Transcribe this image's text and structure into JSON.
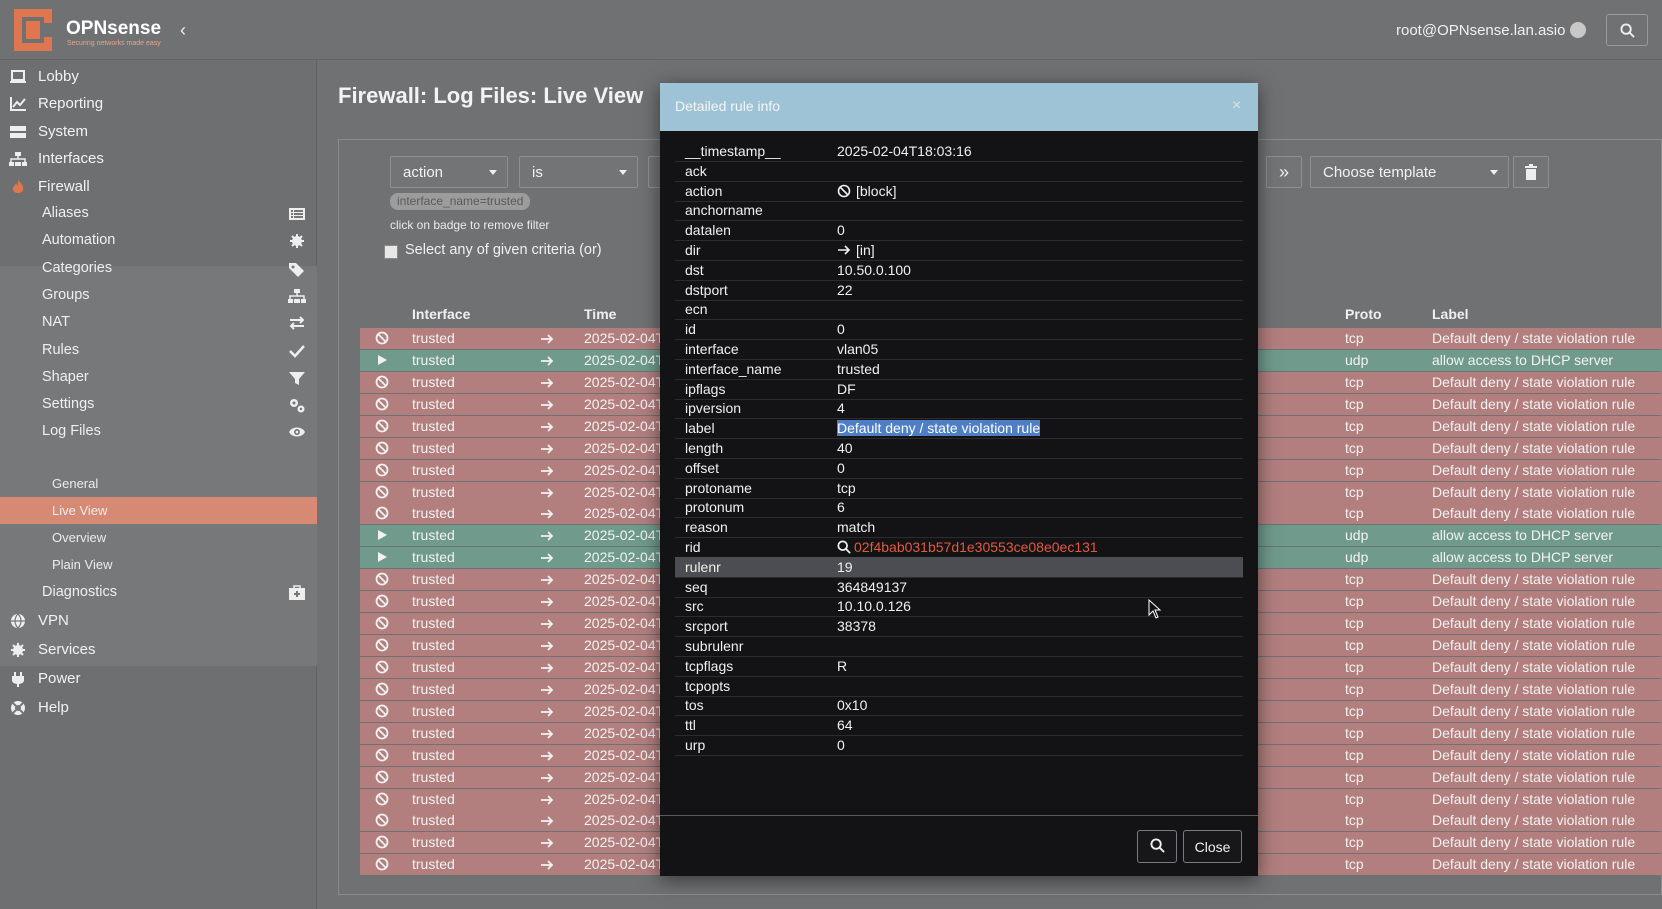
{
  "header": {
    "brand": "OPNsense",
    "tagline": "Securing networks made easy",
    "user": "root@OPNsense.lan.asio"
  },
  "sidebar": {
    "items": [
      {
        "label": "Lobby",
        "icon": "laptop-icon"
      },
      {
        "label": "Reporting",
        "icon": "chart-icon"
      },
      {
        "label": "System",
        "icon": "server-icon"
      },
      {
        "label": "Interfaces",
        "icon": "sitemap-icon"
      },
      {
        "label": "Firewall",
        "icon": "fire-icon"
      }
    ],
    "firewall_sub": [
      {
        "label": "Aliases",
        "icon": "list-icon"
      },
      {
        "label": "Automation",
        "icon": "gear-icon"
      },
      {
        "label": "Categories",
        "icon": "tags-icon"
      },
      {
        "label": "Groups",
        "icon": "sitemap-icon"
      },
      {
        "label": "NAT",
        "icon": "exchange-icon"
      },
      {
        "label": "Rules",
        "icon": "check-icon"
      },
      {
        "label": "Shaper",
        "icon": "filter-icon"
      },
      {
        "label": "Settings",
        "icon": "gears-icon"
      },
      {
        "label": "Log Files",
        "icon": "eye-icon"
      }
    ],
    "logfiles_sub": [
      "General",
      "Live View",
      "Overview",
      "Plain View"
    ],
    "diagnostics": {
      "label": "Diagnostics",
      "icon": "medkit-icon"
    },
    "bottom": [
      {
        "label": "VPN",
        "icon": "globe-icon"
      },
      {
        "label": "Services",
        "icon": "cog-icon"
      },
      {
        "label": "Power",
        "icon": "plug-icon"
      },
      {
        "label": "Help",
        "icon": "lifering-icon"
      }
    ]
  },
  "page": {
    "title": "Firewall: Log Files: Live View",
    "filter_field": "action",
    "filter_op": "is",
    "badge": "interface_name=trusted",
    "hint": "click on badge to remove filter",
    "criteria_label": "Select any of given criteria (or)",
    "template": "Choose template",
    "columns": {
      "interface": "Interface",
      "time": "Time",
      "proto": "Proto",
      "label": "Label"
    }
  },
  "rows": [
    {
      "action": "block",
      "iface": "trusted",
      "time": "2025-02-04T",
      "proto": "tcp",
      "label": "Default deny / state violation rule"
    },
    {
      "action": "pass",
      "iface": "trusted",
      "time": "2025-02-04T",
      "proto": "udp",
      "label": "allow access to DHCP server"
    },
    {
      "action": "block",
      "iface": "trusted",
      "time": "2025-02-04T",
      "proto": "tcp",
      "label": "Default deny / state violation rule"
    },
    {
      "action": "block",
      "iface": "trusted",
      "time": "2025-02-04T",
      "proto": "tcp",
      "label": "Default deny / state violation rule"
    },
    {
      "action": "block",
      "iface": "trusted",
      "time": "2025-02-04T",
      "proto": "tcp",
      "label": "Default deny / state violation rule"
    },
    {
      "action": "block",
      "iface": "trusted",
      "time": "2025-02-04T",
      "proto": "tcp",
      "label": "Default deny / state violation rule"
    },
    {
      "action": "block",
      "iface": "trusted",
      "time": "2025-02-04T",
      "proto": "tcp",
      "label": "Default deny / state violation rule"
    },
    {
      "action": "block",
      "iface": "trusted",
      "time": "2025-02-04T",
      "proto": "tcp",
      "label": "Default deny / state violation rule"
    },
    {
      "action": "block",
      "iface": "trusted",
      "time": "2025-02-04T",
      "proto": "tcp",
      "label": "Default deny / state violation rule"
    },
    {
      "action": "pass",
      "iface": "trusted",
      "time": "2025-02-04T",
      "proto": "udp",
      "label": "allow access to DHCP server"
    },
    {
      "action": "pass",
      "iface": "trusted",
      "time": "2025-02-04T",
      "proto": "udp",
      "label": "allow access to DHCP server"
    },
    {
      "action": "block",
      "iface": "trusted",
      "time": "2025-02-04T",
      "proto": "tcp",
      "label": "Default deny / state violation rule"
    },
    {
      "action": "block",
      "iface": "trusted",
      "time": "2025-02-04T",
      "proto": "tcp",
      "label": "Default deny / state violation rule"
    },
    {
      "action": "block",
      "iface": "trusted",
      "time": "2025-02-04T",
      "proto": "tcp",
      "label": "Default deny / state violation rule"
    },
    {
      "action": "block",
      "iface": "trusted",
      "time": "2025-02-04T",
      "proto": "tcp",
      "label": "Default deny / state violation rule"
    },
    {
      "action": "block",
      "iface": "trusted",
      "time": "2025-02-04T",
      "proto": "tcp",
      "label": "Default deny / state violation rule"
    },
    {
      "action": "block",
      "iface": "trusted",
      "time": "2025-02-04T",
      "proto": "tcp",
      "label": "Default deny / state violation rule"
    },
    {
      "action": "block",
      "iface": "trusted",
      "time": "2025-02-04T",
      "proto": "tcp",
      "label": "Default deny / state violation rule"
    },
    {
      "action": "block",
      "iface": "trusted",
      "time": "2025-02-04T",
      "proto": "tcp",
      "label": "Default deny / state violation rule"
    },
    {
      "action": "block",
      "iface": "trusted",
      "time": "2025-02-04T",
      "proto": "tcp",
      "label": "Default deny / state violation rule"
    },
    {
      "action": "block",
      "iface": "trusted",
      "time": "2025-02-04T",
      "proto": "tcp",
      "label": "Default deny / state violation rule"
    },
    {
      "action": "block",
      "iface": "trusted",
      "time": "2025-02-04T",
      "proto": "tcp",
      "label": "Default deny / state violation rule"
    },
    {
      "action": "block",
      "iface": "trusted",
      "time": "2025-02-04T",
      "proto": "tcp",
      "label": "Default deny / state violation rule"
    },
    {
      "action": "block",
      "iface": "trusted",
      "time": "2025-02-04T",
      "proto": "tcp",
      "label": "Default deny / state violation rule"
    },
    {
      "action": "block",
      "iface": "trusted",
      "time": "2025-02-04T",
      "proto": "tcp",
      "label": "Default deny / state violation rule"
    }
  ],
  "modal": {
    "title": "Detailed rule info",
    "close_label": "Close",
    "fields": [
      {
        "k": "__timestamp__",
        "v": "2025-02-04T18:03:16"
      },
      {
        "k": "ack",
        "v": ""
      },
      {
        "k": "action",
        "v": "[block]",
        "icon": "block"
      },
      {
        "k": "anchorname",
        "v": ""
      },
      {
        "k": "datalen",
        "v": "0"
      },
      {
        "k": "dir",
        "v": "[in]",
        "icon": "arrow"
      },
      {
        "k": "dst",
        "v": "10.50.0.100"
      },
      {
        "k": "dstport",
        "v": "22"
      },
      {
        "k": "ecn",
        "v": ""
      },
      {
        "k": "id",
        "v": "0"
      },
      {
        "k": "interface",
        "v": "vlan05"
      },
      {
        "k": "interface_name",
        "v": "trusted"
      },
      {
        "k": "ipflags",
        "v": "DF"
      },
      {
        "k": "ipversion",
        "v": "4"
      },
      {
        "k": "label",
        "v": "Default deny / state violation rule",
        "selected": true
      },
      {
        "k": "length",
        "v": "40"
      },
      {
        "k": "offset",
        "v": "0"
      },
      {
        "k": "protoname",
        "v": "tcp"
      },
      {
        "k": "protonum",
        "v": "6"
      },
      {
        "k": "reason",
        "v": "match"
      },
      {
        "k": "rid",
        "v": "02f4bab031b57d1e30553ce08e0ec131",
        "icon": "search",
        "link": true
      },
      {
        "k": "rulenr",
        "v": "19",
        "highlight": true
      },
      {
        "k": "seq",
        "v": "364849137"
      },
      {
        "k": "src",
        "v": "10.10.0.126"
      },
      {
        "k": "srcport",
        "v": "38378"
      },
      {
        "k": "subrulenr",
        "v": ""
      },
      {
        "k": "tcpflags",
        "v": "R"
      },
      {
        "k": "tcpopts",
        "v": ""
      },
      {
        "k": "tos",
        "v": "0x10"
      },
      {
        "k": "ttl",
        "v": "64"
      },
      {
        "k": "urp",
        "v": "0"
      }
    ]
  },
  "colors": {
    "accent": "#d68a73",
    "block_row": "#b27e7e",
    "pass_row": "#6f9a8c",
    "modal_header": "#9fc3d6",
    "rid_link": "#e2593f"
  }
}
